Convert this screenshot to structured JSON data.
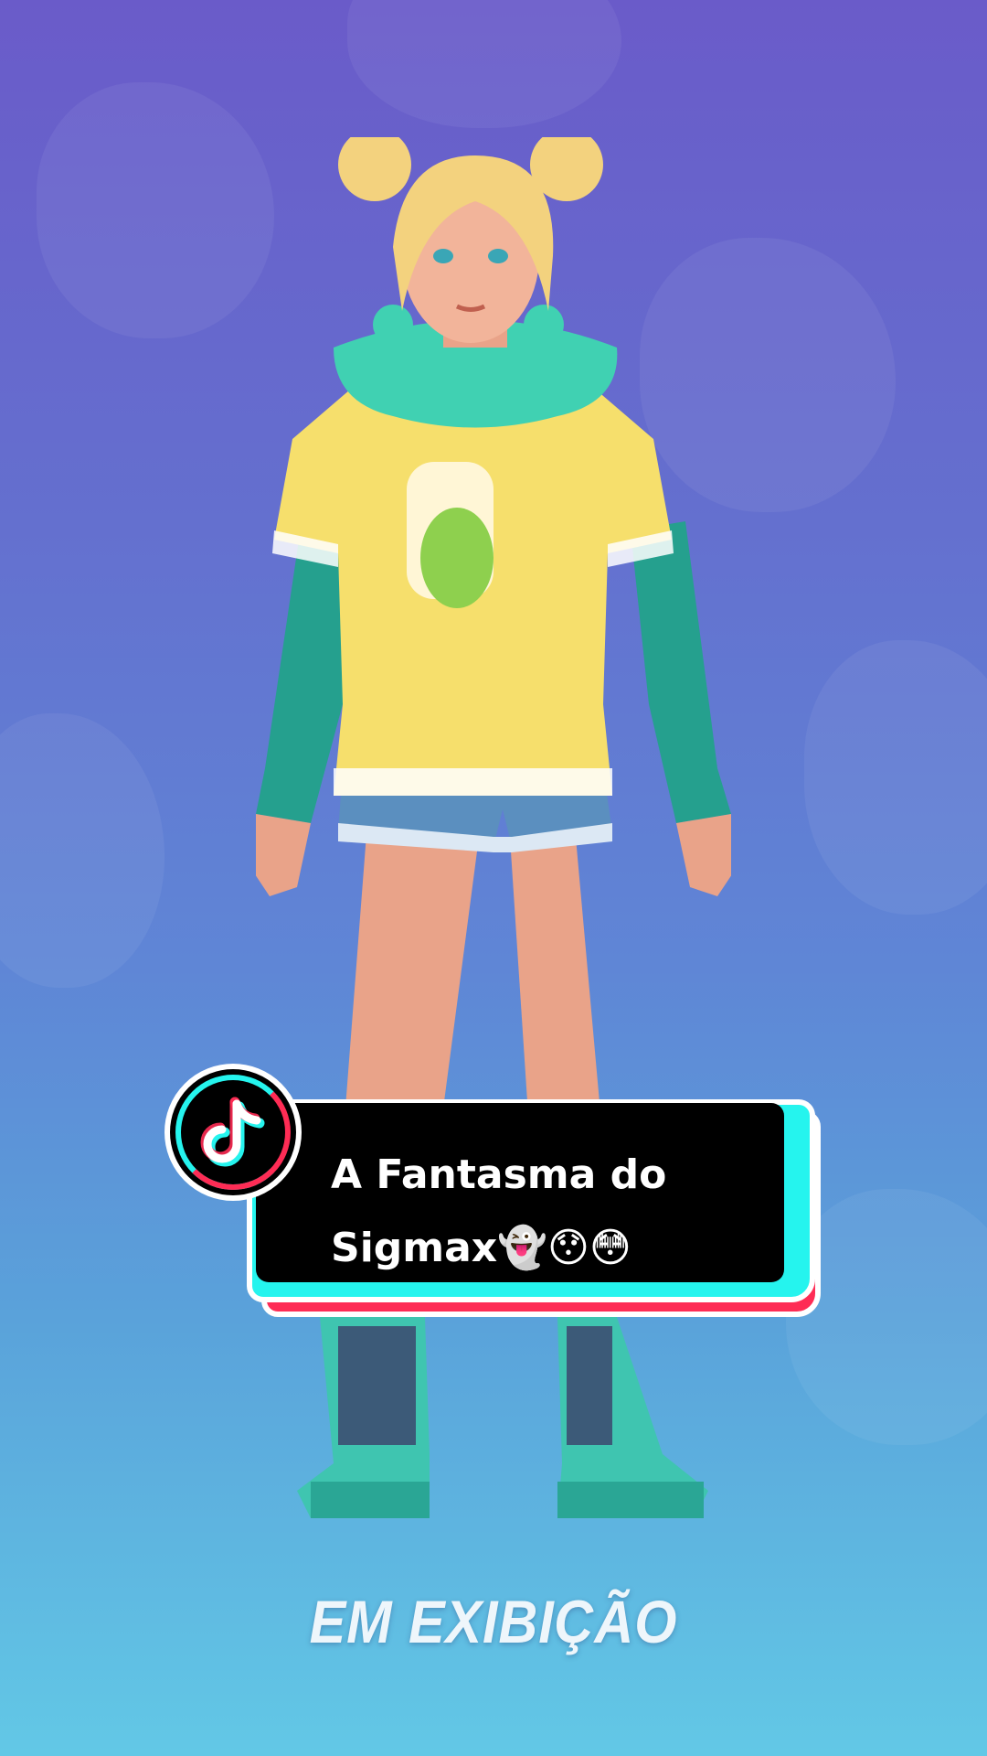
{
  "caption": {
    "line1": "A Fantasma do",
    "line2": "Sigmax👻😯😳"
  },
  "status_label": "EM EXIBIÇÃO",
  "badge": {
    "icon": "tiktok-logo-icon"
  },
  "colors": {
    "bg_top": "#6a5bc9",
    "bg_bottom": "#62c8e6",
    "tiktok_cyan": "#25f4ee",
    "tiktok_red": "#fe2c55"
  }
}
